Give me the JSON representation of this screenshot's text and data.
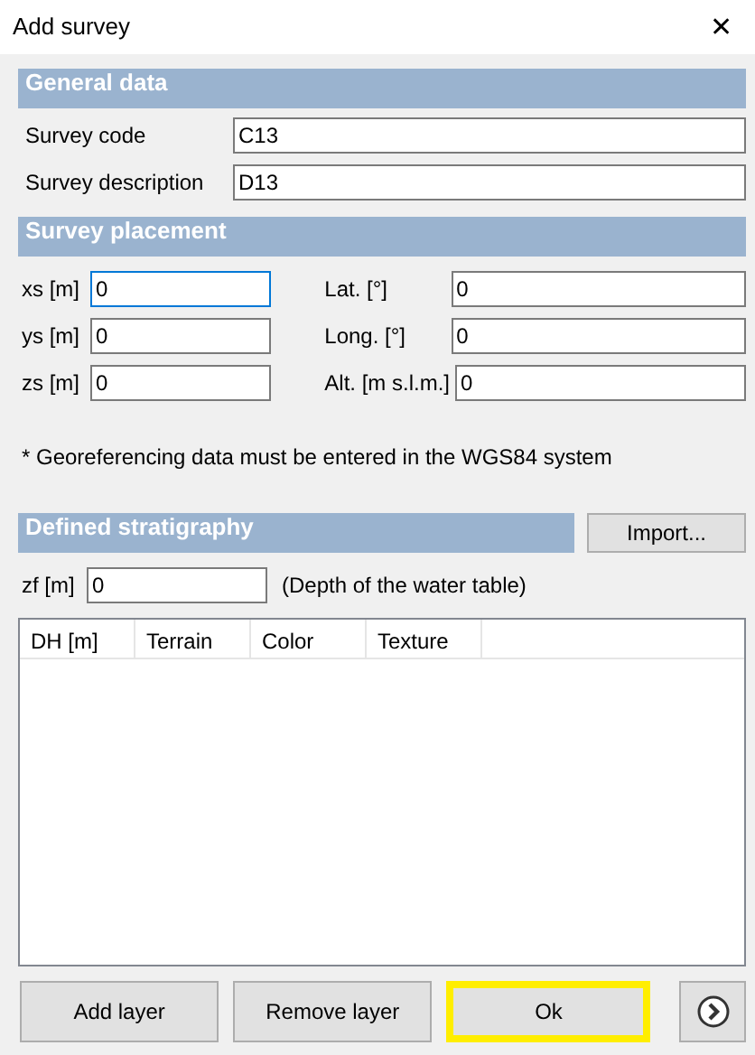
{
  "window": {
    "title": "Add survey",
    "close": "✕"
  },
  "general": {
    "title": "General data",
    "fields": [
      {
        "label": "Survey code",
        "value": "C13"
      },
      {
        "label": "Survey description",
        "value": "D13"
      }
    ]
  },
  "placement": {
    "title": "Survey placement",
    "left": [
      {
        "label": "xs [m]",
        "value": "0",
        "focused": true
      },
      {
        "label": "ys [m]",
        "value": "0",
        "focused": false
      },
      {
        "label": "zs [m]",
        "value": "0",
        "focused": false
      }
    ],
    "right": [
      {
        "label": "Lat. [°]",
        "value": "0",
        "focused": false
      },
      {
        "label": "Long. [°]",
        "value": "0",
        "focused": false
      },
      {
        "label": "Alt. [m s.l.m.]",
        "value": "0",
        "focused": false
      }
    ],
    "note": "* Georeferencing data must be entered in the WGS84 system"
  },
  "stratigraphy": {
    "title": "Defined stratigraphy",
    "import_button": "Import...",
    "water": {
      "label": "zf [m]",
      "value": "0",
      "hint": "(Depth of the water table)"
    },
    "table": {
      "columns": [
        "DH [m]",
        "Terrain",
        "Color",
        "Texture"
      ]
    }
  },
  "buttons": [
    {
      "label": "Add layer",
      "default": false
    },
    {
      "label": "Remove layer",
      "default": false
    },
    {
      "label": "Ok",
      "default": true
    }
  ]
}
